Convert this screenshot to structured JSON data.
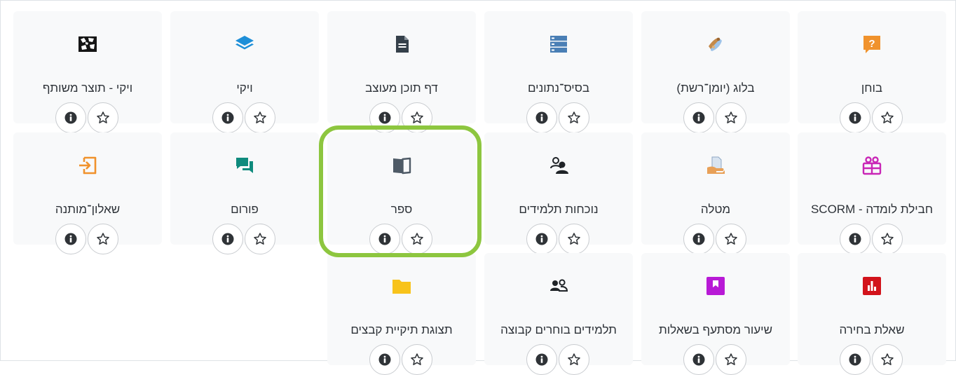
{
  "accent_colors": {
    "highlight": "#8dc63f",
    "tile_bg": "#f8f9fa",
    "quiz_icon": "#f0922c",
    "forum_icon": "#0f8b7d",
    "assign_icon": "#f0922c",
    "scorm_icon": "#c926b6",
    "folder_icon": "#f8c31b",
    "lesson_icon": "#b81ad6",
    "choice_icon": "#d2131b",
    "database_icon": "#4a7fb5",
    "glossary_icon": "#1e8fd8"
  },
  "activities": [
    {
      "key": "wiki-shared",
      "label": "ויקי - תוצר משותף",
      "icon": "wiki-shared-icon"
    },
    {
      "key": "wiki",
      "label": "ויקי",
      "icon": "layers-icon"
    },
    {
      "key": "page",
      "label": "דף תוכן מעוצב",
      "icon": "page-icon"
    },
    {
      "key": "database",
      "label": "בסיס־נתונים",
      "icon": "database-icon"
    },
    {
      "key": "blog",
      "label": "בלוג (יומן־רשת)",
      "icon": "blog-icon"
    },
    {
      "key": "quiz",
      "label": "בוחן",
      "icon": "quiz-icon"
    },
    {
      "key": "feedback",
      "label": "שאלון־מותנה",
      "icon": "feedback-icon"
    },
    {
      "key": "forum",
      "label": "פורום",
      "icon": "forum-icon"
    },
    {
      "key": "book",
      "label": "ספר",
      "icon": "book-icon"
    },
    {
      "key": "attendance",
      "label": "נוכחות תלמידים",
      "icon": "attendance-icon"
    },
    {
      "key": "assignment",
      "label": "מטלה",
      "icon": "assignment-icon"
    },
    {
      "key": "scorm",
      "label": "חבילת לומדה - SCORM",
      "icon": "scorm-icon"
    },
    {
      "key": "folder",
      "label": "תצוגת תיקיית קבצים",
      "icon": "folder-icon"
    },
    {
      "key": "groupselect",
      "label": "תלמידים בוחרים קבוצה",
      "icon": "group-select-icon"
    },
    {
      "key": "lesson",
      "label": "שיעור מסתעף בשאלות",
      "icon": "lesson-icon"
    },
    {
      "key": "choice",
      "label": "שאלת בחירה",
      "icon": "choice-icon"
    }
  ],
  "buttons": {
    "info_icon": "info-icon",
    "star_icon": "star-icon"
  },
  "highlighted_activity": "book"
}
